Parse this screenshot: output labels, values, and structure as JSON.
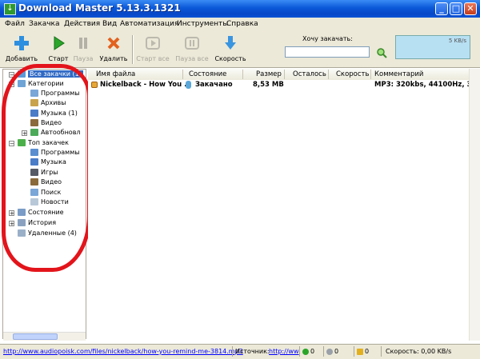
{
  "window": {
    "title": "Download Master 5.13.3.1321",
    "buttons": {
      "minimize": "_",
      "maximize": "□",
      "close": "✕"
    }
  },
  "menu": [
    "Файл",
    "Закачка",
    "Действия",
    "Вид",
    "Автоматизация",
    "Инструменты",
    "Справка"
  ],
  "toolbar": {
    "add": "Добавить",
    "start": "Старт",
    "pause": "Пауза",
    "delete": "Удалить",
    "start_all": "Старт все",
    "pause_all": "Пауза все",
    "speed": "Скорость",
    "want_download_label": "Хочу закачать:",
    "want_download_value": "",
    "speed_graph_label": "5 KB/s"
  },
  "tree": {
    "all_downloads": "Все закачки (1)",
    "categories": "Категории",
    "programs": "Программы",
    "archives": "Архивы",
    "music": "Музыка (1)",
    "video": "Видео",
    "autoupdate": "Автообновл",
    "top_downloads": "Топ закачек",
    "top_programs": "Программы",
    "top_music": "Музыка",
    "top_games": "Игры",
    "top_video": "Видео",
    "top_search": "Поиск",
    "top_news": "Новости",
    "state": "Состояние",
    "history": "История",
    "deleted": "Удаленные (4)"
  },
  "table": {
    "columns": [
      "Имя файла",
      "Состояние",
      "Размер",
      "Осталось",
      "Скорость",
      "Комментарий"
    ],
    "rows": [
      {
        "name": "Nickelback - How You ...",
        "state": "Закачано",
        "size": "8,53 MB",
        "left": "",
        "speed": "",
        "comment": "MP3: 320kbs, 44100Hz, 3:43"
      }
    ]
  },
  "status": {
    "url": "http://www.audiopoisk.com/files/nickelback/how-you-remind-me-3814.mp3",
    "source_label": "Источник:",
    "source_value": "http://ww",
    "count_1": "0",
    "count_2": "0",
    "count_3": "0",
    "speed": "Скорость: 0,00 KB/s"
  },
  "colors": {
    "annotation": "#e3141b",
    "selection": "#316ac5",
    "titlebar": "#0a58d8"
  }
}
